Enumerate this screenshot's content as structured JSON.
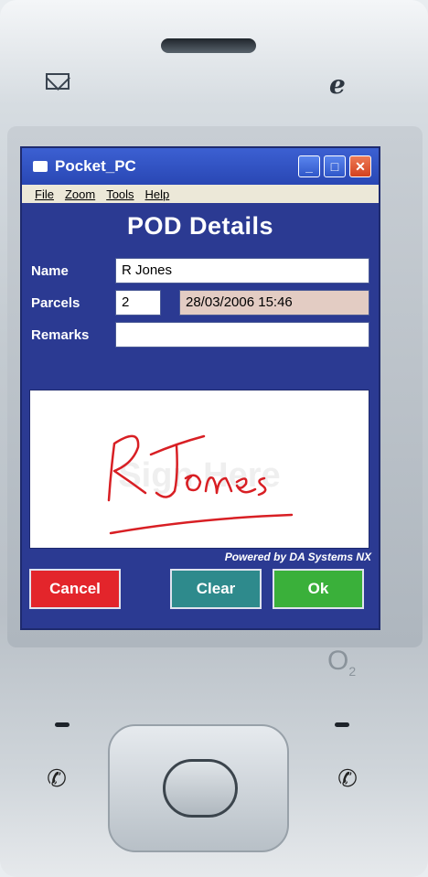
{
  "window": {
    "title": "Pocket_PC"
  },
  "menu": [
    "File",
    "Zoom",
    "Tools",
    "Help"
  ],
  "form": {
    "header": "POD Details",
    "name_label": "Name",
    "name_value": "R Jones",
    "parcels_label": "Parcels",
    "parcels_value": "2",
    "timestamp": "28/03/2006 15:46",
    "remarks_label": "Remarks",
    "remarks_value": ""
  },
  "signature": {
    "watermark": "Sign Here",
    "signed_name": "R Jones"
  },
  "footer": {
    "powered_by": "Powered by DA Systems NX"
  },
  "buttons": {
    "cancel": "Cancel",
    "clear": "Clear",
    "ok": "Ok"
  },
  "device": {
    "brand": "O",
    "brand_sub": "2"
  },
  "colors": {
    "screen_bg": "#2b3a92",
    "titlebar": "#3c60d2",
    "cancel": "#e3252b",
    "clear": "#2e8a8c",
    "ok": "#3ab03a",
    "signature_ink": "#d81f24"
  }
}
